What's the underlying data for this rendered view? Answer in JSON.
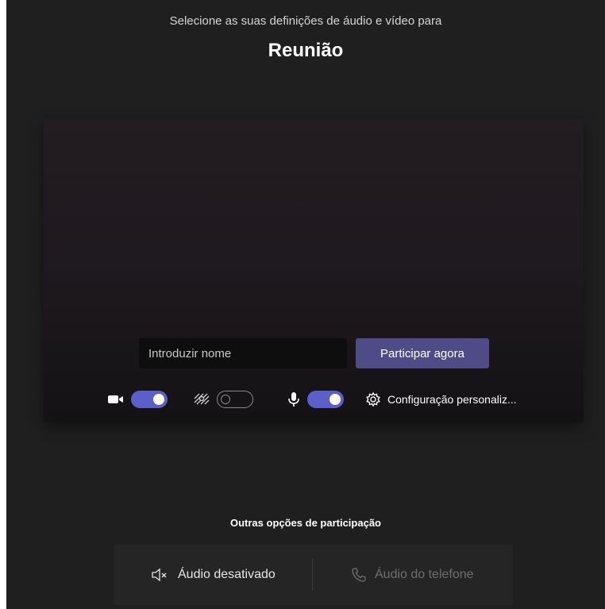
{
  "header": {
    "subtitle": "Selecione as suas definições de áudio e vídeo para",
    "title": "Reunião"
  },
  "join": {
    "name_placeholder": "Introduzir nome",
    "name_value": "",
    "join_label": "Participar agora"
  },
  "controls": {
    "camera": {
      "icon": "camera-icon",
      "on": true
    },
    "background_blur": {
      "icon": "background-effects-icon",
      "on": false
    },
    "microphone": {
      "icon": "microphone-icon",
      "on": true
    },
    "settings": {
      "icon": "gear-icon",
      "label": "Configuração personaliz..."
    }
  },
  "other_options": {
    "title": "Outras opções de participação",
    "audio_off_label": "Áudio desativado",
    "phone_audio_label": "Áudio do telefone"
  },
  "colors": {
    "background": "#1f1f1f",
    "accent": "#5b5fc7",
    "join_button": "#4f4b86"
  }
}
